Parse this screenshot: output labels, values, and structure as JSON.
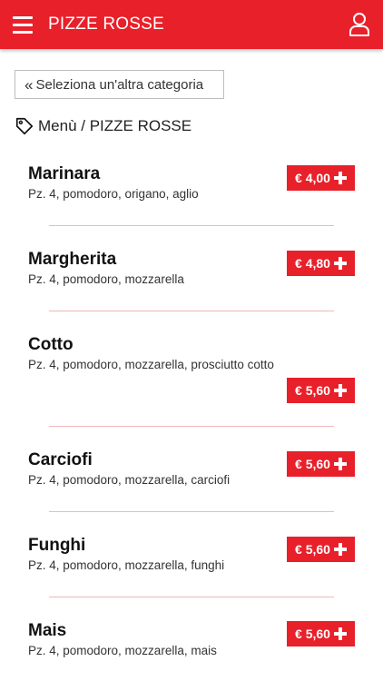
{
  "header": {
    "title": "PIZZE ROSSE",
    "menu_icon": "hamburger-menu-icon",
    "user_icon": "user-profile-icon",
    "color": "#e8202a"
  },
  "back_button": {
    "icon": "double-chevron-left-icon",
    "label": "Seleziona un'altra categoria"
  },
  "breadcrumb": {
    "icon": "tag-icon",
    "text": "Menù / PIZZE ROSSE"
  },
  "items": [
    {
      "name": "Marinara",
      "description": "Pz. 4, pomodoro, origano, aglio",
      "price": "€ 4,00"
    },
    {
      "name": "Margherita",
      "description": "Pz. 4, pomodoro, mozzarella",
      "price": "€ 4,80"
    },
    {
      "name": "Cotto",
      "description": "Pz. 4, pomodoro, mozzarella, prosciutto cotto",
      "price": "€ 5,60"
    },
    {
      "name": "Carciofi",
      "description": "Pz. 4, pomodoro, mozzarella, carciofi",
      "price": "€ 5,60"
    },
    {
      "name": "Funghi",
      "description": "Pz. 4, pomodoro, mozzarella, funghi",
      "price": "€ 5,60"
    },
    {
      "name": "Mais",
      "description": "Pz. 4, pomodoro, mozzarella, mais",
      "price": "€ 5,60"
    }
  ]
}
